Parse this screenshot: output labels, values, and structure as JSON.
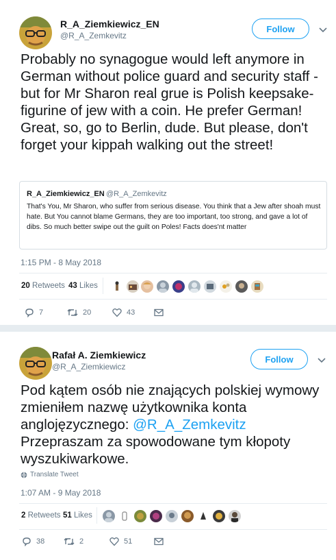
{
  "tweets": [
    {
      "name": "R_A_Ziemkiewicz_EN",
      "handle": "@R_A_Zemkevitz",
      "follow_label": "Follow",
      "text": "Probably no synagogue would left anymore in German without police guard and security staff - but for Mr Sharon real grue is Polish keepsake-figurine of jew with a coin. He prefer German! Great, so, go to Berlin, dude. But please, don't forget your kippah walking out the street!",
      "quote": {
        "name": "R_A_Ziemkiewicz_EN",
        "handle": "@R_A_Zemkevitz",
        "text": "That's You, Mr Sharon, who suffer from serious disease. You think that a Jew after shoah must hate. But You cannot blame Germans, they are too important, too strong, and gave a lot of dibs. So much better swipe out the guilt on Poles! Facts does'nt matter"
      },
      "timestamp": "1:15 PM - 8 May 2018",
      "retweets_count": "20",
      "retweets_label": "Retweets",
      "likes_count": "43",
      "likes_label": "Likes",
      "reply_count": "7",
      "retweet_action_count": "20",
      "like_action_count": "43"
    },
    {
      "name": "Rafał A. Ziemkiewicz",
      "handle": "@R_A_Ziemkiewicz",
      "follow_label": "Follow",
      "text_before": "Pod kątem osób nie znających polskiej wymowy zmieniłem nazwę użytkownika konta anglojęzycznego: ",
      "mention": "@R_A_Zemkevitz",
      "text_after": " Przepraszam za spowodowane tym kłopoty wyszukiwarkowe.",
      "translate_label": "Translate Tweet",
      "timestamp": "1:07 AM - 9 May 2018",
      "retweets_count": "2",
      "retweets_label": "Retweets",
      "likes_count": "51",
      "likes_label": "Likes",
      "reply_count": "38",
      "retweet_action_count": "2",
      "like_action_count": "51"
    }
  ],
  "colors": {
    "accent": "#1da1f2",
    "secondary_text": "#657786",
    "border": "#e6ecf0"
  }
}
